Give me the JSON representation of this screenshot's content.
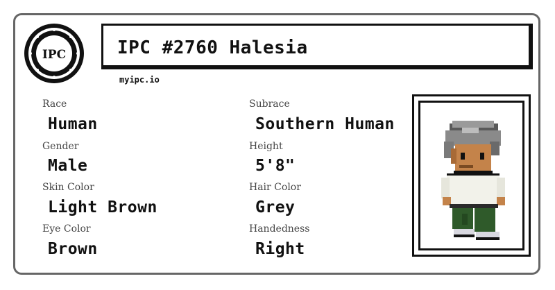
{
  "card": {
    "logo_text": "IPC",
    "title": "IPC #2760 Halesia",
    "site": "myipc.io"
  },
  "fields": [
    {
      "label": "Race",
      "value": "Human"
    },
    {
      "label": "Gender",
      "value": "Male"
    },
    {
      "label": "Skin Color",
      "value": "Light Brown"
    },
    {
      "label": "Eye Color",
      "value": "Brown"
    },
    {
      "label": "Subrace",
      "value": "Southern Human"
    },
    {
      "label": "Height",
      "value": "5'8\""
    },
    {
      "label": "Hair Color",
      "value": "Grey"
    },
    {
      "label": "Handedness",
      "value": "Right"
    }
  ],
  "colors": {
    "border": "#666666",
    "ink": "#111111",
    "label": "#444444",
    "hair": "#8a8a8a",
    "skin": "#c4834a",
    "shirt": "#f2f2ea",
    "pants": "#2f5a2a",
    "shoes": "#d8d8e0"
  },
  "portrait": {
    "icon": "character-sprite-icon"
  }
}
